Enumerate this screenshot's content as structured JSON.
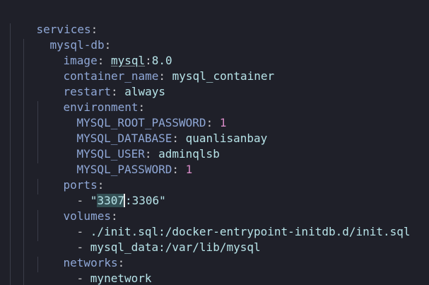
{
  "yaml": {
    "services_key": "services",
    "service_name": "mysql-db",
    "image_key": "image",
    "image_name": "mysql",
    "image_tag": "8.0",
    "container_name_key": "container_name",
    "container_name_value": "mysql_container",
    "restart_key": "restart",
    "restart_value": "always",
    "environment_key": "environment",
    "env": {
      "root_password_key": "MYSQL_ROOT_PASSWORD",
      "root_password_value": "1",
      "database_key": "MYSQL_DATABASE",
      "database_value": "quanlisanbay",
      "user_key": "MYSQL_USER",
      "user_value": "adminqlsb",
      "password_key": "MYSQL_PASSWORD",
      "password_value": "1"
    },
    "ports_key": "ports",
    "port_host": "3307",
    "port_container": "3306",
    "volumes_key": "volumes",
    "volume_1": "./init.sql:/docker-entrypoint-initdb.d/init.sql",
    "volume_2": "mysql_data:/var/lib/mysql",
    "networks_key": "networks",
    "network_1": "mynetwork"
  },
  "colors": {
    "background": "#1f2029",
    "key": "#8fa7d6",
    "value": "#b7e3e8",
    "number": "#d68ac6",
    "indent_guide": "#3a3d49",
    "selection": "#345055"
  }
}
